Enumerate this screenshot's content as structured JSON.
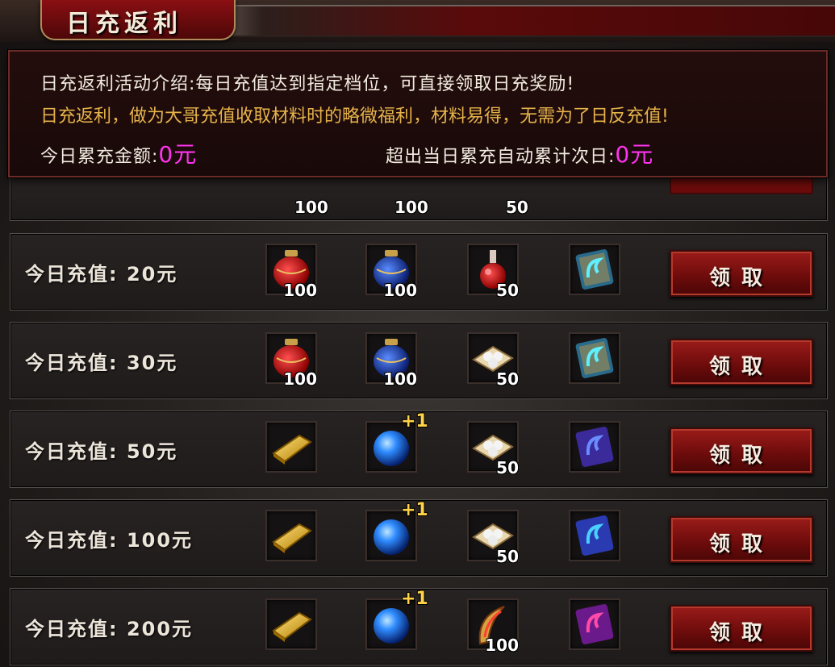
{
  "header": {
    "title": "日充返利"
  },
  "intro": {
    "line1": "日充返利活动介绍:每日充值达到指定档位，可直接领取日充奖励!",
    "line2": "日充返利，做为大哥充值收取材料时的略微福利，材料易得，无需为了日反充值!",
    "today_total_label": "今日累充金额:",
    "today_total_value": "0元",
    "overflow_label": "超出当日累充自动累计次日:",
    "overflow_value": "0元"
  },
  "partial_row": {
    "counts": [
      "100",
      "100",
      "50"
    ]
  },
  "rows": [
    {
      "label": "今日充值: 20元",
      "button": "领取",
      "items": [
        {
          "icon": "red-potion-jar-icon",
          "count": "100"
        },
        {
          "icon": "blue-potion-jar-icon",
          "count": "100"
        },
        {
          "icon": "red-flask-icon",
          "count": "50"
        },
        {
          "icon": "cyan-scroll-icon",
          "count": ""
        }
      ]
    },
    {
      "label": "今日充值: 30元",
      "button": "领取",
      "items": [
        {
          "icon": "red-potion-jar-icon",
          "count": "100"
        },
        {
          "icon": "blue-potion-jar-icon",
          "count": "100"
        },
        {
          "icon": "pill-packet-icon",
          "count": "50"
        },
        {
          "icon": "cyan-scroll-icon",
          "count": ""
        }
      ]
    },
    {
      "label": "今日充值: 50元",
      "button": "领取",
      "items": [
        {
          "icon": "gold-bar-icon",
          "count": ""
        },
        {
          "icon": "blue-orb-icon",
          "count": "",
          "badge": "+1"
        },
        {
          "icon": "pill-packet-icon",
          "count": "50"
        },
        {
          "icon": "purple-scroll-icon",
          "count": ""
        }
      ]
    },
    {
      "label": "今日充值: 100元",
      "button": "领取",
      "items": [
        {
          "icon": "gold-bar-icon",
          "count": ""
        },
        {
          "icon": "blue-orb-icon",
          "count": "",
          "badge": "+1"
        },
        {
          "icon": "pill-packet-icon",
          "count": "50"
        },
        {
          "icon": "blue-scroll-icon",
          "count": ""
        }
      ]
    },
    {
      "label": "今日充值: 200元",
      "button": "领取",
      "items": [
        {
          "icon": "gold-bar-icon",
          "count": ""
        },
        {
          "icon": "blue-orb-icon",
          "count": "",
          "badge": "+1"
        },
        {
          "icon": "golden-horn-icon",
          "count": "100"
        },
        {
          "icon": "magenta-scroll-icon",
          "count": ""
        }
      ]
    }
  ],
  "colors": {
    "accent": "#ff33ee",
    "gold_text": "#e6b34a",
    "button_red": "#7a0f0e"
  }
}
